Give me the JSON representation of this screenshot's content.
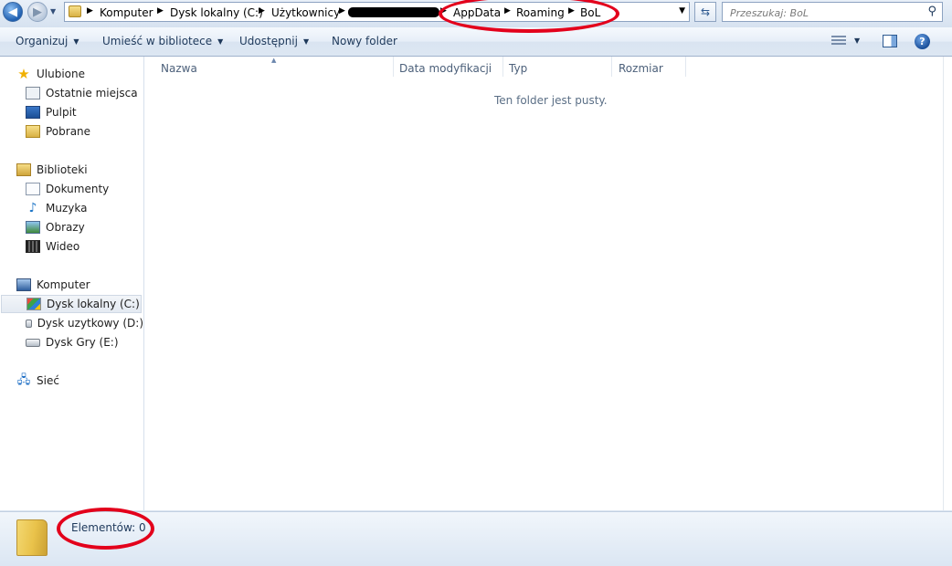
{
  "address": {
    "crumbs": [
      "Komputer",
      "Dysk lokalny (C:)",
      "Użytkownicy",
      "AppData",
      "Roaming",
      "BoL"
    ]
  },
  "search": {
    "placeholder": "Przeszukaj: BoL"
  },
  "toolbar": {
    "organize": "Organizuj",
    "include_library": "Umieść w bibliotece",
    "share": "Udostępnij",
    "new_folder": "Nowy folder"
  },
  "nav": {
    "favorites": {
      "label": "Ulubione",
      "items": [
        "Ostatnie miejsca",
        "Pulpit",
        "Pobrane"
      ]
    },
    "libraries": {
      "label": "Biblioteki",
      "items": [
        "Dokumenty",
        "Muzyka",
        "Obrazy",
        "Wideo"
      ]
    },
    "computer": {
      "label": "Komputer",
      "items": [
        "Dysk lokalny (C:)",
        "Dysk uzytkowy (D:)",
        "Dysk Gry (E:)"
      ]
    },
    "network": {
      "label": "Sieć"
    }
  },
  "columns": [
    "Nazwa",
    "Data modyfikacji",
    "Typ",
    "Rozmiar"
  ],
  "content": {
    "empty_message": "Ten folder jest pusty."
  },
  "details": {
    "items_count": "Elementów: 0"
  },
  "colors": {
    "annotation_red": "#e3001b",
    "window_bg": "#dbe5f1"
  },
  "icons": [
    "back-arrow-icon",
    "forward-arrow-icon",
    "folder-icon",
    "refresh-icon",
    "search-icon",
    "view-options-icon",
    "preview-pane-icon",
    "help-icon"
  ]
}
